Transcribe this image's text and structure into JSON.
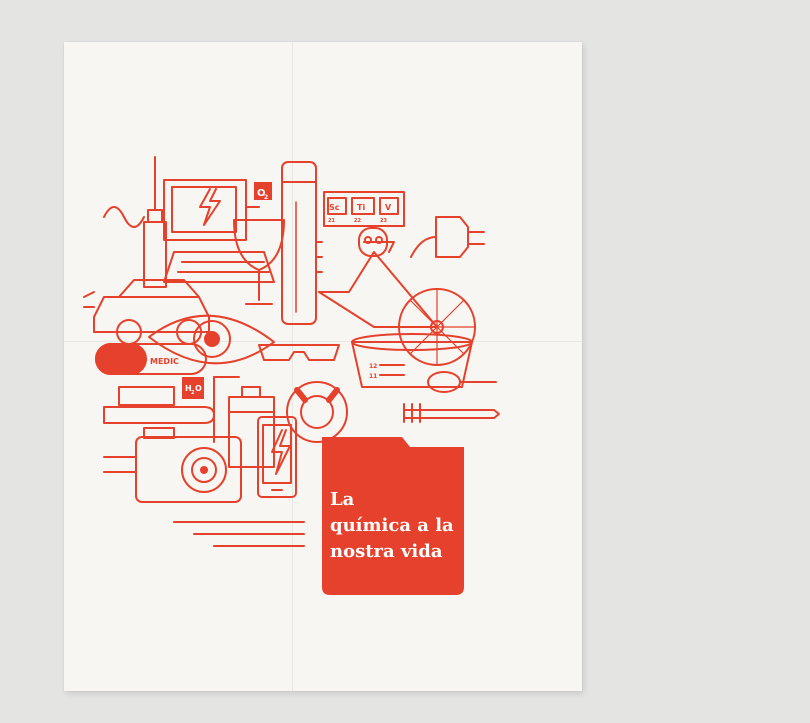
{
  "poster": {
    "title_lines": [
      "La",
      "química a la",
      "nostra vida"
    ],
    "labels": {
      "oxygen": "O",
      "oxygen_sub": "2",
      "element_sc": "Sc",
      "element_ti": "Ti",
      "element_v": "V",
      "num_sc": "21",
      "num_ti": "22",
      "num_v": "23",
      "medic": "MEDIC",
      "water": "H",
      "water_sub": "2",
      "water_o": "O",
      "scale_12": "12",
      "scale_11": "11"
    },
    "colors": {
      "accent": "#e6412c",
      "paper": "#f7f6f2",
      "background": "#e4e4e3"
    }
  }
}
